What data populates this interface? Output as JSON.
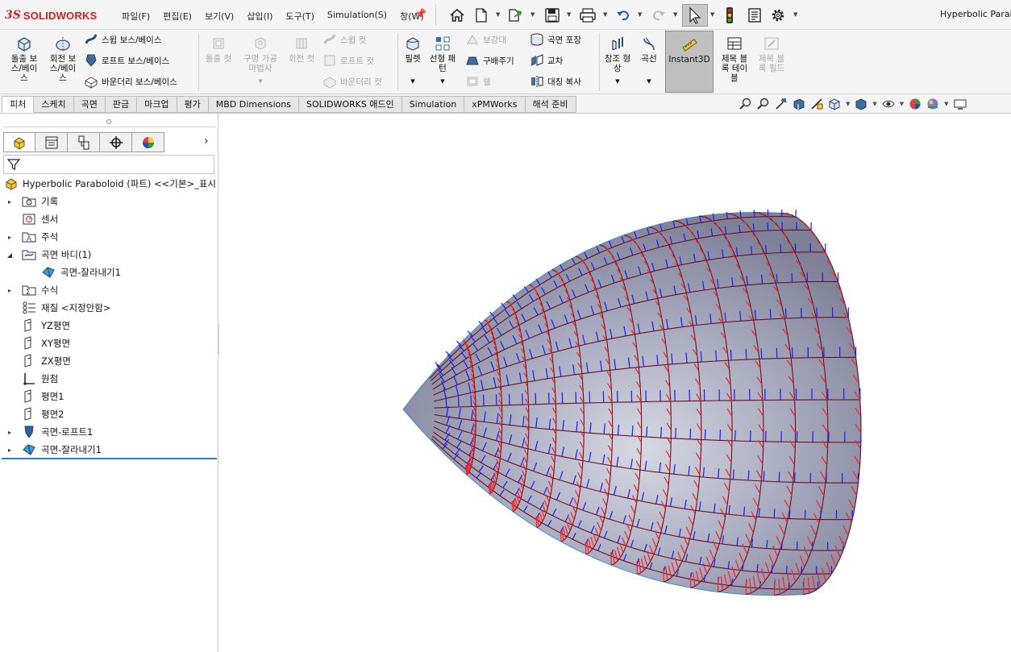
{
  "app": {
    "logo_text": "SOLIDWORKS",
    "window_title": "Hyperbolic Parabo"
  },
  "menu": {
    "items": [
      "파일(F)",
      "편집(E)",
      "보기(V)",
      "삽입(I)",
      "도구(T)",
      "Simulation(S)",
      "창(W)"
    ]
  },
  "toolbar_icons": [
    "home-icon",
    "new-document-icon",
    "open-icon",
    "save-icon",
    "print-icon",
    "undo-icon",
    "redo-icon",
    "select-icon",
    "rebuild-traffic-light-icon",
    "file-properties-icon",
    "options-gear-icon"
  ],
  "commands": {
    "extrude_boss": "돌출 보\n스/베이\n스",
    "revolve_boss": "회전 보\n스/베이\n스",
    "sweep_boss": "스윕 보스/베이스",
    "loft_boss": "로프트 보스/베이스",
    "boundary_boss": "바운더리 보스/베이스",
    "extrude_cut": "돌출 컷",
    "hole_wizard": "구멍 가공\n마법사",
    "revolve_cut": "회전 컷",
    "sweep_cut": "스윕 컷",
    "loft_cut": "로프트 컷",
    "boundary_cut": "바운더리 컷",
    "fillet": "필렛",
    "linear_pattern": "선형 패\n턴",
    "rib": "보강대",
    "draft": "구배주기",
    "shell": "쉘",
    "wrap": "곡면 포장",
    "intersect": "교차",
    "mirror": "대칭 복사",
    "reference_geometry": "참조 형\n상",
    "curves": "곡선",
    "instant3d": "Instant3D",
    "block_table": "제목 블\n록 테이\n블",
    "block_field": "제목 블\n록 필드"
  },
  "tabs": [
    {
      "label": "피처",
      "active": true
    },
    {
      "label": "스케치",
      "active": false
    },
    {
      "label": "곡면",
      "active": false
    },
    {
      "label": "판금",
      "active": false
    },
    {
      "label": "마크업",
      "active": false
    },
    {
      "label": "평가",
      "active": false
    },
    {
      "label": "MBD Dimensions",
      "active": false
    },
    {
      "label": "SOLIDWORKS 애드인",
      "active": false
    },
    {
      "label": "Simulation",
      "active": false
    },
    {
      "label": "xPMWorks",
      "active": false
    },
    {
      "label": "해석 준비",
      "active": false
    }
  ],
  "view_icons": [
    "zoom-to-fit-icon",
    "zoom-area-icon",
    "previous-view-icon",
    "section-view-icon",
    "dynamic-annotation-icon",
    "view-orientation-icon",
    "display-style-icon",
    "hide-show-icon",
    "edit-appearance-icon",
    "scene-icon",
    "view-settings-icon"
  ],
  "panel_tabs": [
    "feature-manager-icon",
    "property-manager-icon",
    "configuration-manager-icon",
    "dimxpert-icon",
    "display-manager-icon"
  ],
  "tree": {
    "root": "Hyperbolic Paraboloid (파트) <<기본>_표시",
    "items": [
      {
        "label": "기록",
        "icon": "history-folder-icon",
        "expandable": true,
        "expanded": false,
        "indent": 0
      },
      {
        "label": "센서",
        "icon": "sensor-icon",
        "expandable": false,
        "expanded": false,
        "indent": 0
      },
      {
        "label": "주석",
        "icon": "annotations-icon",
        "expandable": true,
        "expanded": false,
        "indent": 0
      },
      {
        "label": "곡면 바디(1)",
        "icon": "surface-bodies-folder-icon",
        "expandable": true,
        "expanded": true,
        "indent": 0
      },
      {
        "label": "곡면-잘라내기1",
        "icon": "surface-trim-icon",
        "expandable": false,
        "expanded": false,
        "indent": 1
      },
      {
        "label": "수식",
        "icon": "equations-icon",
        "expandable": true,
        "expanded": false,
        "indent": 0
      },
      {
        "label": "재질 <지정안함>",
        "icon": "material-icon",
        "expandable": false,
        "expanded": false,
        "indent": 0
      },
      {
        "label": "YZ평면",
        "icon": "plane-icon",
        "expandable": false,
        "expanded": false,
        "indent": 0
      },
      {
        "label": "XY평면",
        "icon": "plane-icon",
        "expandable": false,
        "expanded": false,
        "indent": 0
      },
      {
        "label": "ZX평면",
        "icon": "plane-icon",
        "expandable": false,
        "expanded": false,
        "indent": 0
      },
      {
        "label": "원점",
        "icon": "origin-icon",
        "expandable": false,
        "expanded": false,
        "indent": 0
      },
      {
        "label": "평면1",
        "icon": "plane-icon",
        "expandable": false,
        "expanded": false,
        "indent": 0
      },
      {
        "label": "평면2",
        "icon": "plane-icon",
        "expandable": false,
        "expanded": false,
        "indent": 0
      },
      {
        "label": "곡면-로프트1",
        "icon": "surface-loft-icon",
        "expandable": true,
        "expanded": false,
        "indent": 0
      },
      {
        "label": "곡면-잘라내기1",
        "icon": "surface-trim-icon",
        "expandable": true,
        "expanded": false,
        "indent": 0
      }
    ]
  },
  "colors": {
    "accent_red": "#d21f26",
    "selection_blue": "#2f7fc4",
    "surface_fill": "#8f92a8",
    "curvature_red": "#ff2020",
    "curvature_blue": "#1c1cf0",
    "grid_dark": "#6a1020"
  }
}
